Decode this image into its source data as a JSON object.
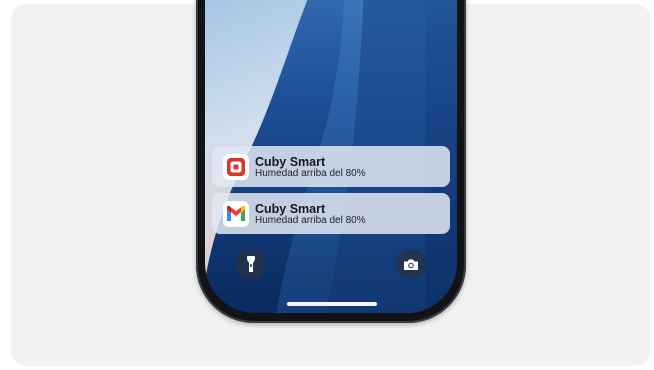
{
  "notifications": [
    {
      "app_icon": "cuby-app-icon",
      "title": "Cuby Smart",
      "body": "Humedad arriba del 80%"
    },
    {
      "app_icon": "gmail-icon",
      "title": "Cuby Smart",
      "body": "Humedad arriba del 80%"
    }
  ],
  "lock_screen": {
    "left_button_icon": "flashlight-icon",
    "right_button_icon": "camera-icon"
  },
  "colors": {
    "cuby_red": "#d8342a",
    "gmail_red": "#ea4335",
    "gmail_blue": "#4285f4",
    "gmail_green": "#34a853",
    "gmail_yellow": "#fbbc04"
  }
}
